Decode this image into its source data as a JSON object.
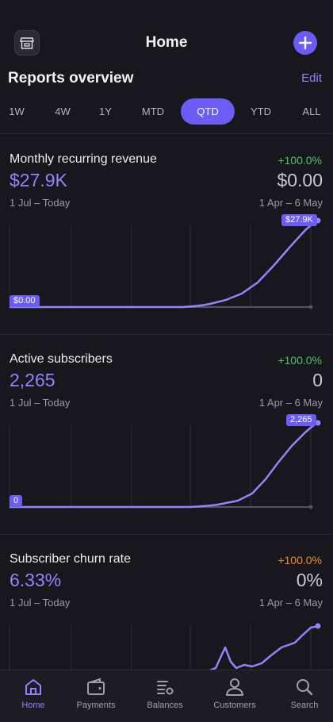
{
  "header": {
    "title": "Home",
    "left_icon": "store-icon",
    "right_icon": "plus-icon"
  },
  "overview": {
    "title": "Reports overview",
    "edit_label": "Edit"
  },
  "tabs": [
    "1W",
    "4W",
    "1Y",
    "MTD",
    "QTD",
    "YTD",
    "ALL"
  ],
  "active_tab": "QTD",
  "colors": {
    "accent": "#6b5cf6",
    "accent_text": "#8f85ff",
    "positive": "#4cc562",
    "warning": "#f28a2e",
    "background": "#17171d"
  },
  "cards": [
    {
      "title": "Monthly recurring revenue",
      "change": "+100.0%",
      "value": "$27.9K",
      "previous_value": "$0.00",
      "range": "1 Jul – Today",
      "previous_range": "1 Apr – 6 May",
      "start_badge": "$0.00",
      "end_badge": "$27.9K"
    },
    {
      "title": "Active subscribers",
      "change": "+100.0%",
      "value": "2,265",
      "previous_value": "0",
      "range": "1 Jul – Today",
      "previous_range": "1 Apr – 6 May",
      "start_badge": "0",
      "end_badge": "2,265"
    },
    {
      "title": "Subscriber churn rate",
      "change": "+100.0%",
      "value": "6.33%",
      "previous_value": "0%",
      "range": "1 Jul – Today",
      "previous_range": "1 Apr – 6 May"
    }
  ],
  "nav": [
    {
      "label": "Home",
      "icon": "home-icon",
      "active": true
    },
    {
      "label": "Payments",
      "icon": "wallet-icon"
    },
    {
      "label": "Balances",
      "icon": "balances-icon"
    },
    {
      "label": "Customers",
      "icon": "person-icon"
    },
    {
      "label": "Search",
      "icon": "search-icon"
    }
  ]
}
